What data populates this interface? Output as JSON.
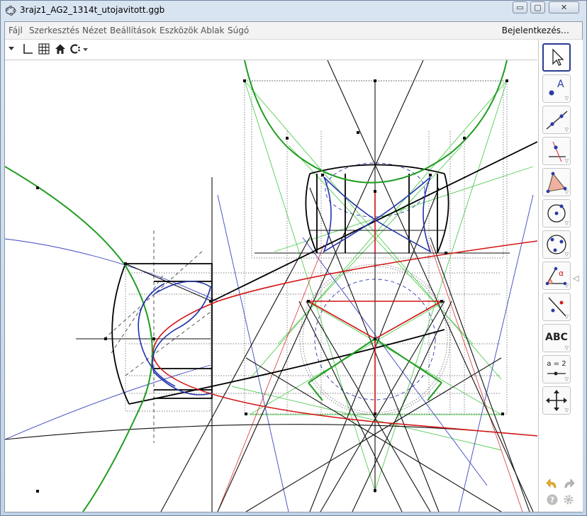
{
  "window": {
    "title": "3rajz1_AG2_1314t_utojavitott.ggb",
    "controls": {
      "minimize": "▭",
      "maximize": "▢",
      "close": "✕"
    }
  },
  "menu": {
    "items": [
      "Fájl",
      "Szerkesztés",
      "Nézet",
      "Beállítások",
      "Eszközök",
      "Ablak",
      "Súgó"
    ],
    "signin": "Bejelentkezés…"
  },
  "stylebar": {
    "icons": [
      "collapse-triangle-icon",
      "axes-icon",
      "grid-icon",
      "home-icon",
      "point-capturing-icon"
    ]
  },
  "toolbar": {
    "tools": [
      {
        "name": "move-tool",
        "label": ""
      },
      {
        "name": "point-tool",
        "label": "A"
      },
      {
        "name": "line-tool",
        "label": ""
      },
      {
        "name": "perpendicular-line-tool",
        "label": ""
      },
      {
        "name": "polygon-tool",
        "label": ""
      },
      {
        "name": "circle-tool",
        "label": ""
      },
      {
        "name": "circle-three-points-tool",
        "label": ""
      },
      {
        "name": "angle-tool",
        "label": "α"
      },
      {
        "name": "reflect-tool",
        "label": ""
      },
      {
        "name": "text-tool",
        "label": "ABC"
      },
      {
        "name": "slider-tool",
        "label": "a = 2"
      },
      {
        "name": "move-graphics-view-tool",
        "label": ""
      }
    ],
    "bottom": [
      "undo-icon",
      "redo-icon",
      "help-icon",
      "settings-icon"
    ]
  },
  "colors": {
    "green": "#1f9d1f",
    "red": "#d41414",
    "blue": "#2233aa",
    "black": "#111111",
    "lightgreen": "#5ad25a",
    "lightblue": "#4455cc"
  }
}
